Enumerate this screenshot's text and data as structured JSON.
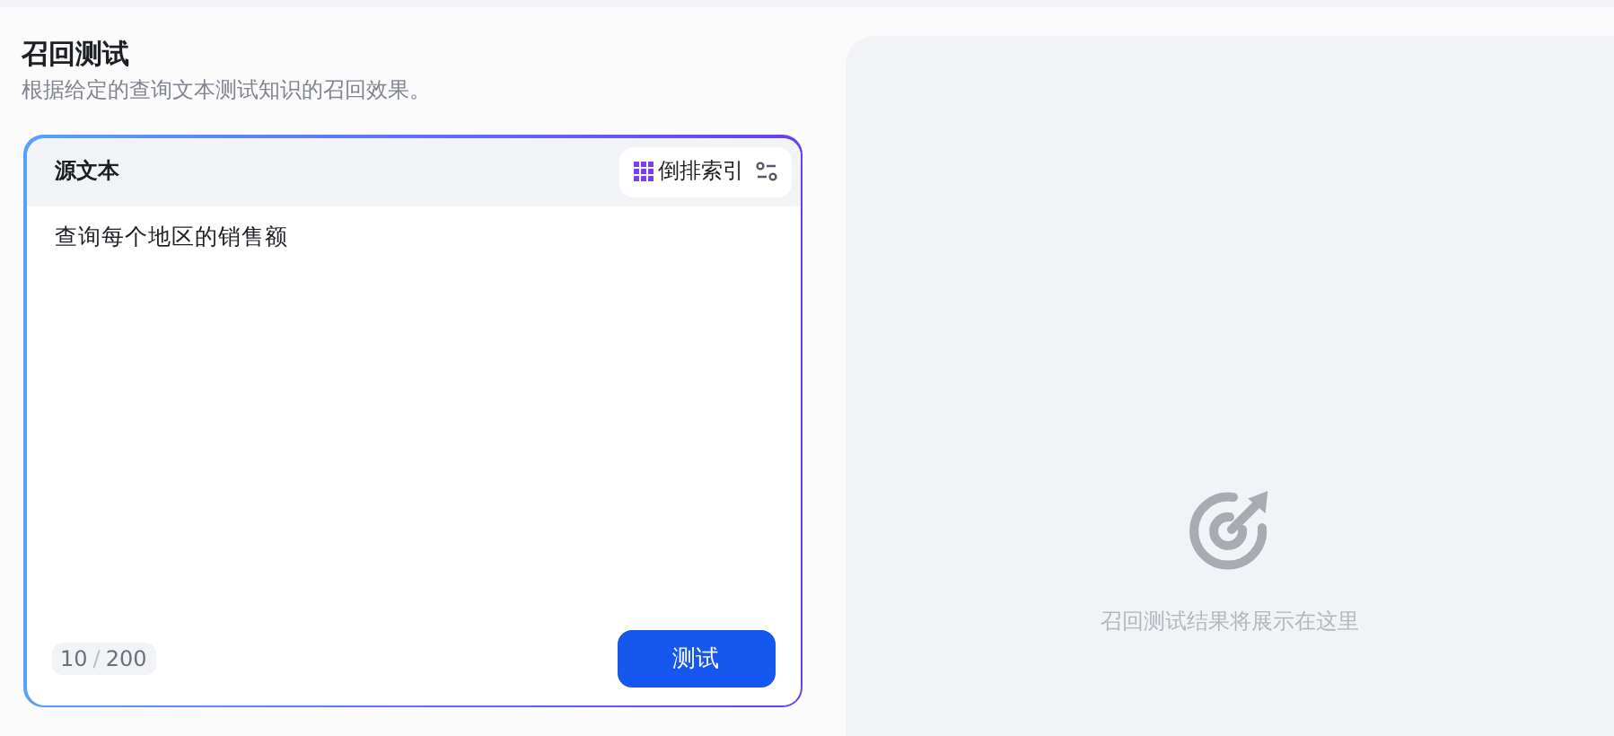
{
  "header": {
    "title": "召回测试",
    "subtitle": "根据给定的查询文本测试知识的召回效果。"
  },
  "source": {
    "label": "源文本",
    "index_mode": "倒排索引",
    "value": "查询每个地区的销售额",
    "counter": {
      "count": "10",
      "separator": "/",
      "max": "200"
    },
    "button": "测试"
  },
  "results": {
    "empty_text": "召回测试结果将展示在这里"
  }
}
